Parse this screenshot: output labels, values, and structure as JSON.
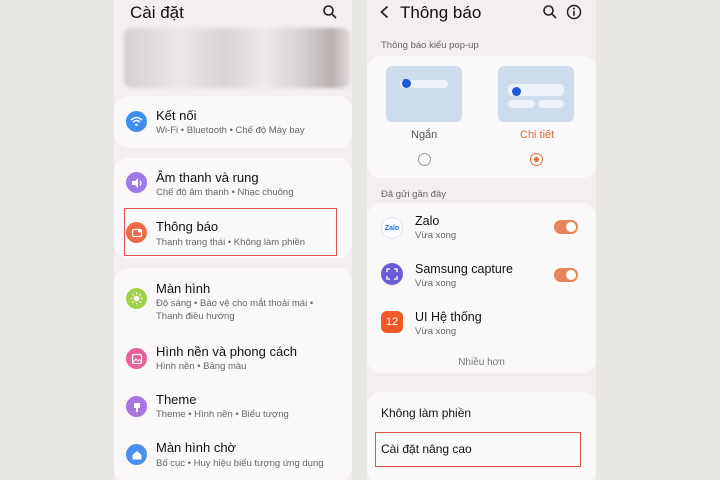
{
  "left": {
    "title": "Cài đặt",
    "items": [
      {
        "title": "Kết nối",
        "sub": [
          "Wi-Fi  •  Bluetooth  •  Chế độ Máy bay"
        ],
        "color": "#3d8ef0",
        "icon": "wifi-icon"
      },
      {
        "title": "Âm thanh và rung",
        "sub": [
          "Chế độ âm thanh  •  Nhạc chuông"
        ],
        "color": "#9b7ae8",
        "icon": "speaker-icon"
      },
      {
        "title": "Thông báo",
        "sub": [
          "Thanh trạng thái  •  Không làm phiền"
        ],
        "color": "#f06a4a",
        "icon": "notification-icon"
      },
      {
        "title": "Màn hình",
        "sub": [
          "Độ sáng  •  Bảo vệ cho mắt thoải mái  •",
          "Thanh điều hướng"
        ],
        "color": "#9fd14a",
        "icon": "brightness-icon"
      },
      {
        "title": "Hình nền và phong cách",
        "sub": [
          "Hình nền  •  Bảng màu"
        ],
        "color": "#e8609a",
        "icon": "wallpaper-icon"
      },
      {
        "title": "Theme",
        "sub": [
          "Theme  •  Hình nền  •  Biểu tượng"
        ],
        "color": "#a874e0",
        "icon": "theme-icon"
      },
      {
        "title": "Màn hình chờ",
        "sub": [
          "Bố cục  •  Huy hiệu biểu tượng ứng dụng"
        ],
        "color": "#4a8ef0",
        "icon": "home-icon"
      }
    ]
  },
  "right": {
    "title": "Thông báo",
    "popup_label": "Thông báo kiểu pop-up",
    "options": [
      {
        "label": "Ngắn",
        "selected": false
      },
      {
        "label": "Chi tiết",
        "selected": true
      }
    ],
    "recent_label": "Đã gửi gần đây",
    "apps": [
      {
        "name": "Zalo",
        "time": "Vừa xong",
        "icon_text": "Zalo",
        "enabled": true
      },
      {
        "name": "Samsung capture",
        "time": "Vừa xong",
        "icon_text": "",
        "enabled": true
      },
      {
        "name": "UI Hệ thống",
        "time": "Vừa xong",
        "icon_text": "12",
        "enabled": false
      }
    ],
    "more": "Nhiều hơn",
    "dnd": "Không làm phiền",
    "advanced": "Cài đặt nâng cao"
  },
  "colors": {
    "accent": "#e06a3a",
    "highlight": "#d9534f",
    "toggle": "#e8845a"
  }
}
